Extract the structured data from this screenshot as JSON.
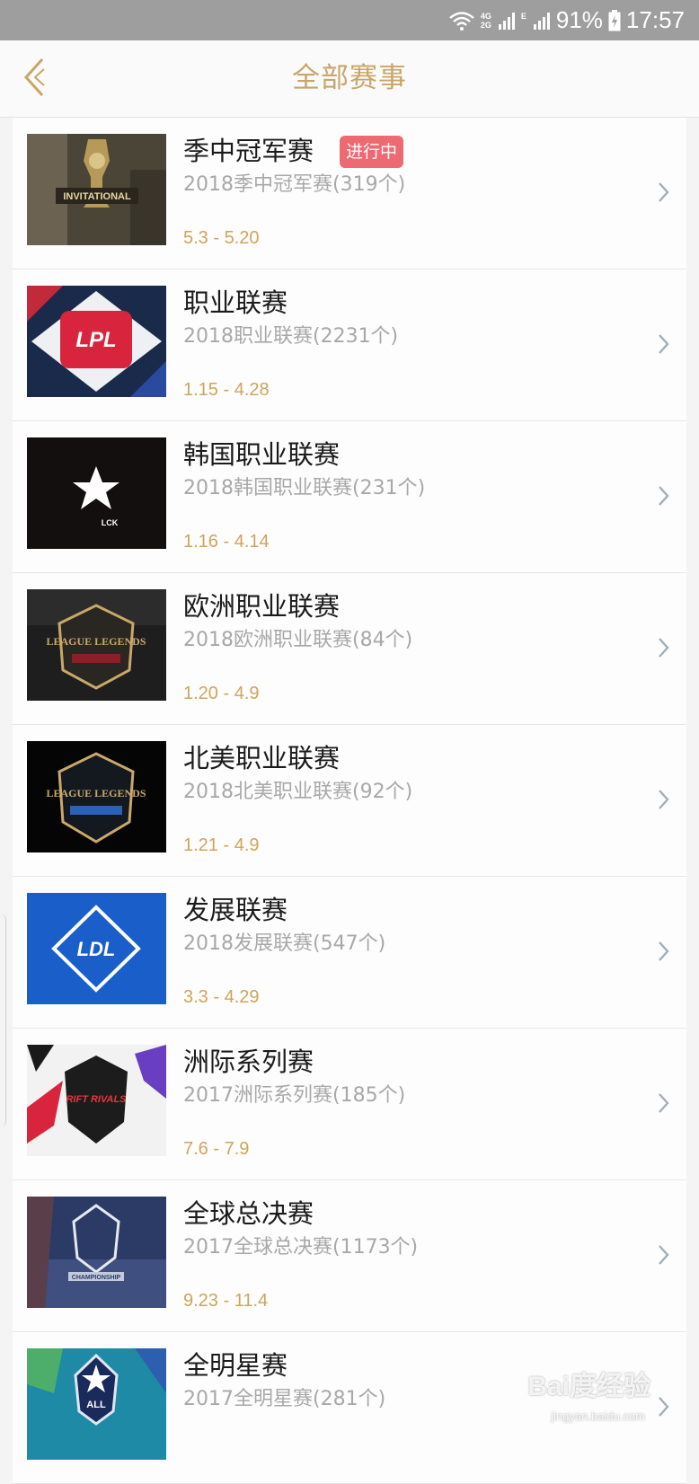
{
  "status_bar": {
    "net_top": "4G",
    "net_bottom": "2G",
    "net_e": "E",
    "battery": "91%",
    "time": "17:57"
  },
  "header": {
    "title": "全部赛事"
  },
  "colors": {
    "accent_gold": "#c8a66a",
    "date_gold": "#cda55c",
    "badge_red": "#ee6a72",
    "status_bar": "#9e9e9e"
  },
  "events": [
    {
      "name": "季中冠军赛",
      "badge": "进行中",
      "subtitle": "2018季中冠军赛(319个)",
      "dates": "5.3 - 5.20",
      "logo_text": "INVITATIONAL",
      "logo": "msi-logo"
    },
    {
      "name": "职业联赛",
      "badge": "",
      "subtitle": "2018职业联赛(2231个)",
      "dates": "1.15 - 4.28",
      "logo_text": "LPL",
      "logo": "lpl-logo"
    },
    {
      "name": "韩国职业联赛",
      "badge": "",
      "subtitle": "2018韩国职业联赛(231个)",
      "dates": "1.16 - 4.14",
      "logo_text": "LCK",
      "logo": "lck-logo"
    },
    {
      "name": "欧洲职业联赛",
      "badge": "",
      "subtitle": "2018欧洲职业联赛(84个)",
      "dates": "1.20 - 4.9",
      "logo_text": "LEAGUE LEGENDS",
      "logo": "eu-lcs-logo"
    },
    {
      "name": "北美职业联赛",
      "badge": "",
      "subtitle": "2018北美职业联赛(92个)",
      "dates": "1.21 - 4.9",
      "logo_text": "LEAGUE LEGENDS",
      "logo": "na-lcs-logo"
    },
    {
      "name": "发展联赛",
      "badge": "",
      "subtitle": "2018发展联赛(547个)",
      "dates": "3.3 - 4.29",
      "logo_text": "LDL",
      "logo": "ldl-logo"
    },
    {
      "name": "洲际系列赛",
      "badge": "",
      "subtitle": "2017洲际系列赛(185个)",
      "dates": "7.6 - 7.9",
      "logo_text": "RIFT RIVALS",
      "logo": "rift-rivals-logo"
    },
    {
      "name": "全球总决赛",
      "badge": "",
      "subtitle": "2017全球总决赛(1173个)",
      "dates": "9.23 - 11.4",
      "logo_text": "CHAMPIONSHIP",
      "logo": "worlds-logo"
    },
    {
      "name": "全明星赛",
      "badge": "",
      "subtitle": "2017全明星赛(281个)",
      "dates": "",
      "logo_text": "ALL",
      "logo": "all-star-logo"
    }
  ],
  "watermark": {
    "brand": "Bai度经验",
    "url": "jingyan.baidu.com"
  }
}
